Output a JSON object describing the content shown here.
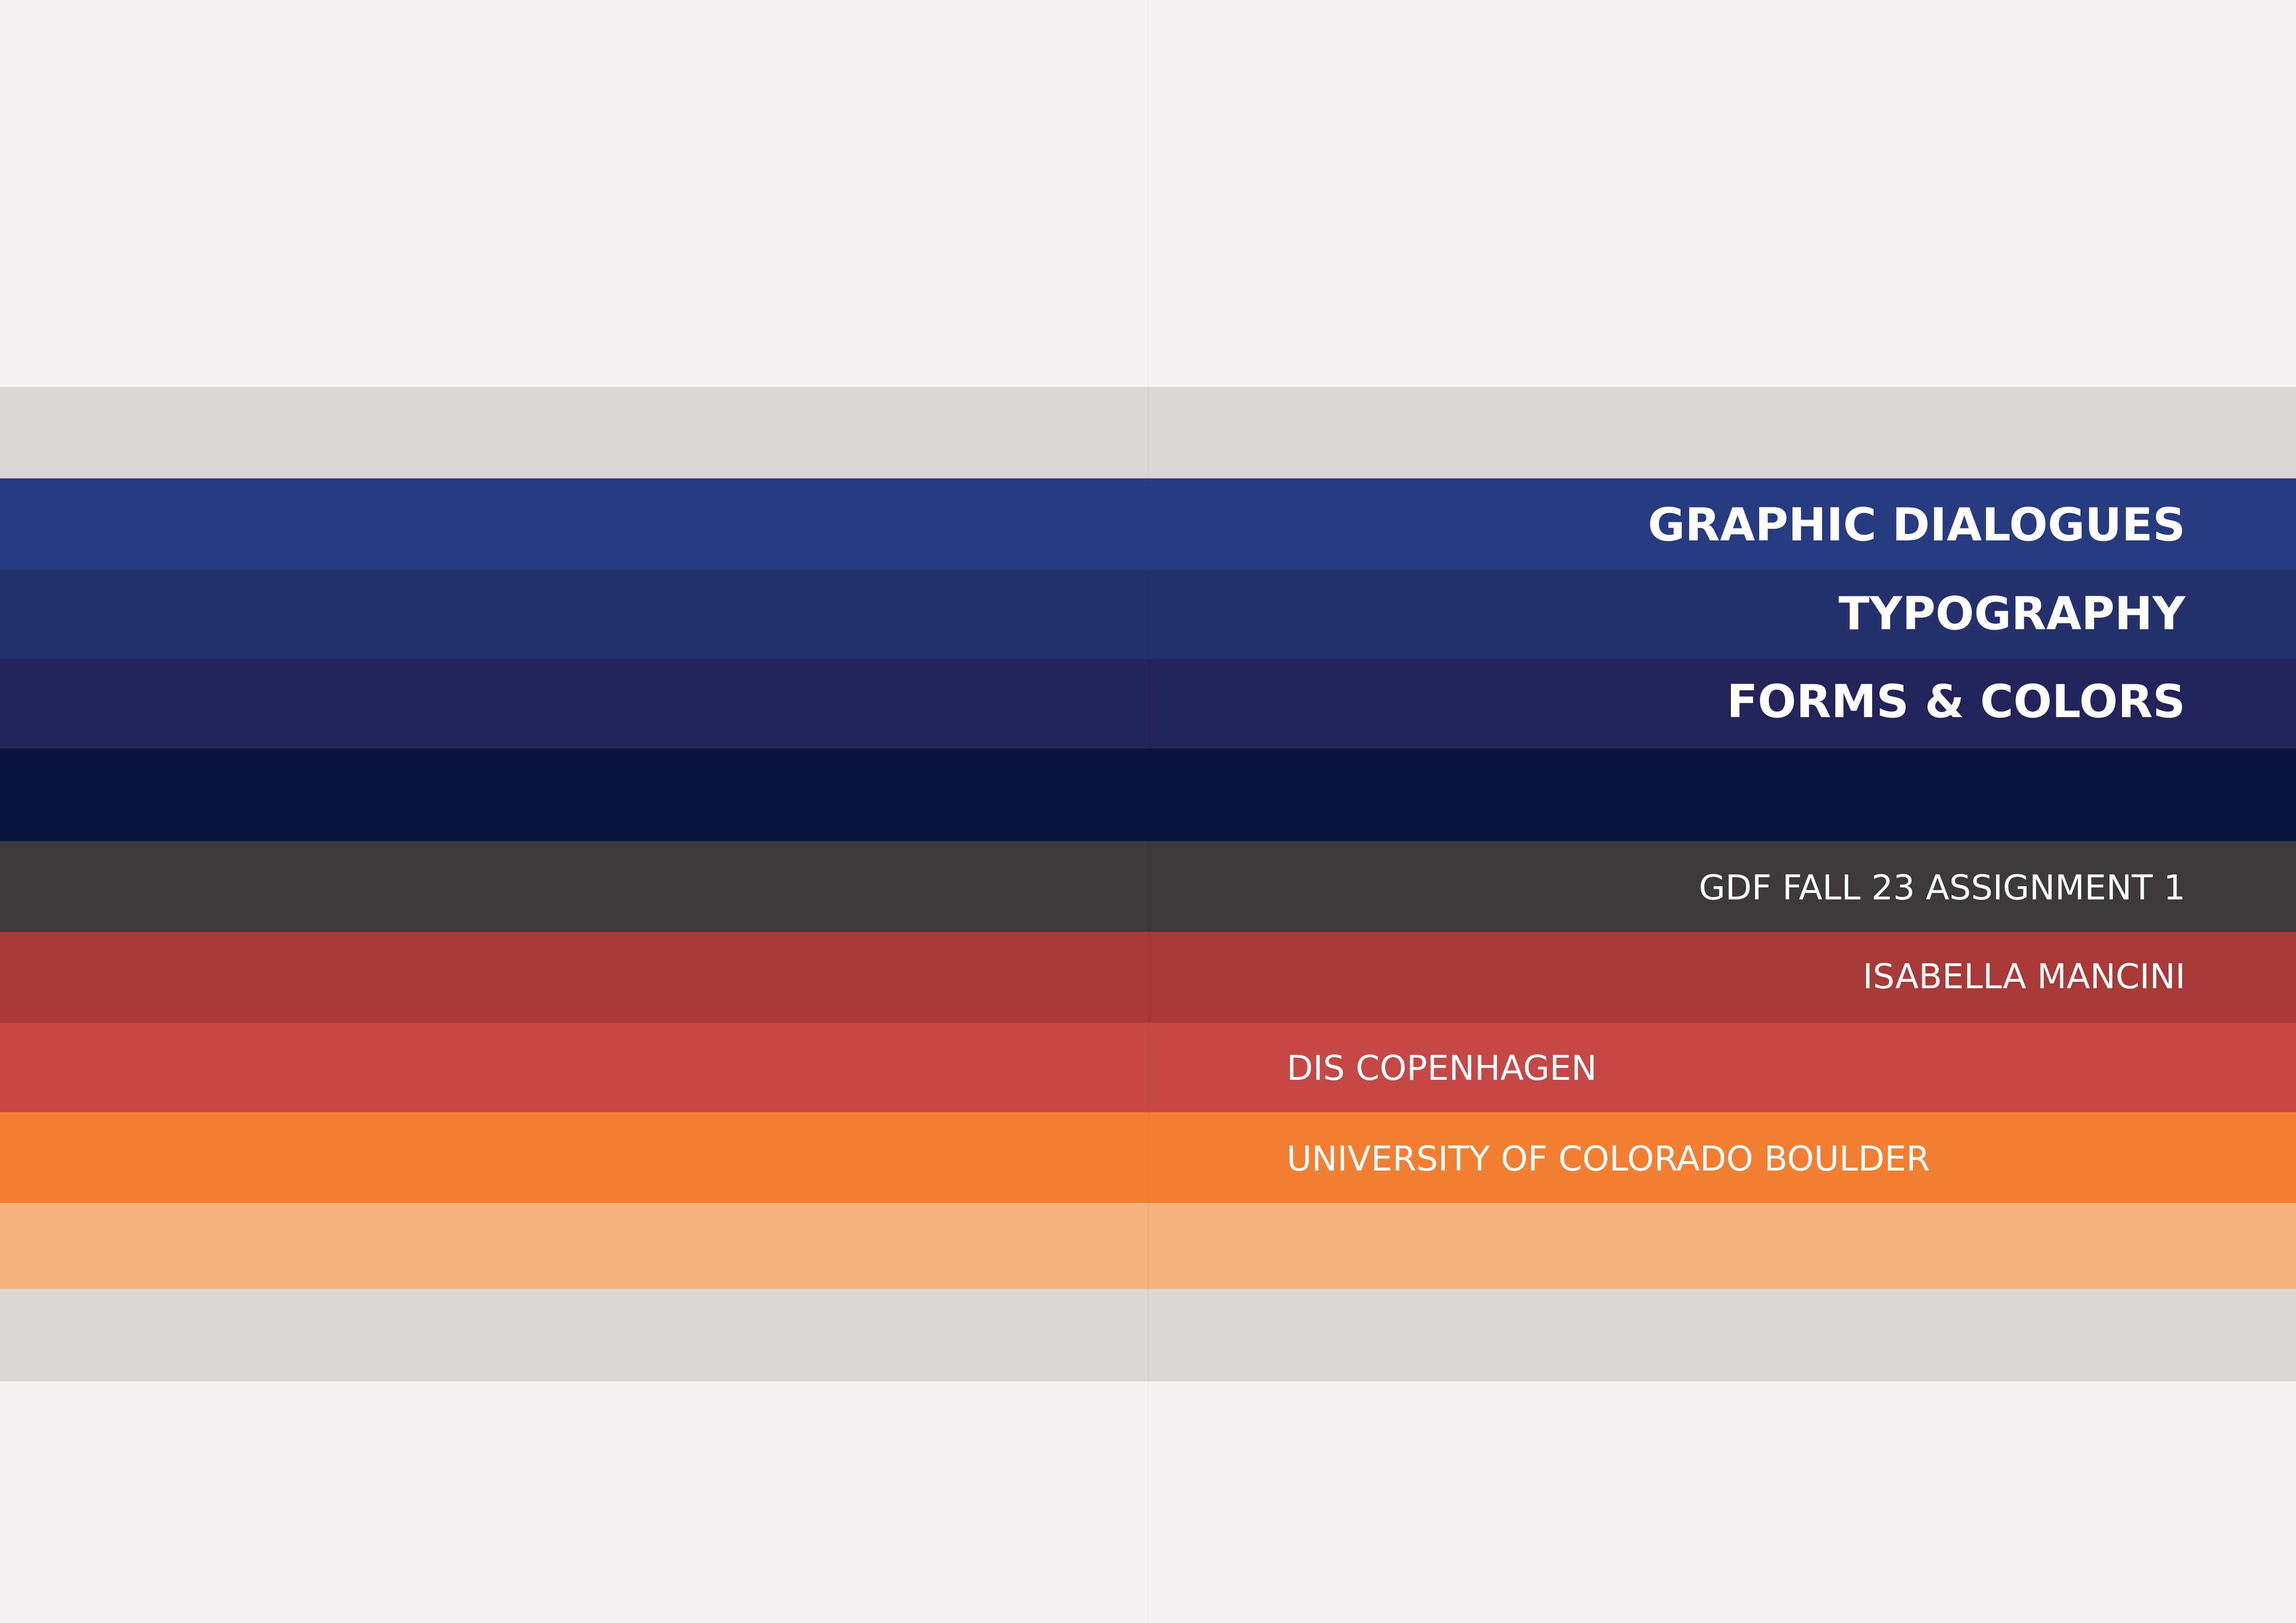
{
  "cover": {
    "title_lines": [
      "GRAPHIC DIALOGUES",
      "TYPOGRAPHY",
      "FORMS  & COLORS"
    ],
    "course": "GDF FALL 23 ASSIGNMENT 1",
    "author": "ISABELLA MANCINI",
    "institutions": [
      "DIS COPENHAGEN",
      "UNIVERSITY OF COLORADO BOULDER"
    ]
  },
  "colors": {
    "background": "#f6f4f4",
    "band_light_gray": "#dad9d6",
    "band_royal_blue": "#273b80",
    "band_navy": "#24316c",
    "band_indigo": "#23235b",
    "band_midnight": "#0c143c",
    "band_charcoal": "#3b3939",
    "band_brick_red": "#a73a36",
    "band_red": "#c54846",
    "band_orange": "#f37f33",
    "band_peach": "#f1b380",
    "text": "#ffffff"
  }
}
